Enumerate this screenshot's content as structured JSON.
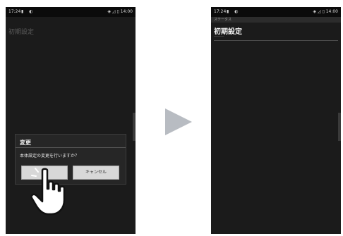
{
  "left_screen": {
    "statusbar": {
      "time": "17:24",
      "notif_icons": "▮ ◐",
      "right_icons": "◈ ◿ ▯ 14:00"
    },
    "title": "初期設定",
    "dialog": {
      "title": "変更",
      "message": "本体設定の変更を行いますか？",
      "ok_label": "OK",
      "cancel_label": "キャンセル"
    }
  },
  "transition": {
    "icon": "play-arrow-icon",
    "color": "#b8bcc2"
  },
  "right_screen": {
    "statusbar": {
      "time": "17:24",
      "notif_icons": "▮ ◐",
      "right_icons": "◈ ◿ ▯ 14:00"
    },
    "appbar_label": "ステータス",
    "title": "初期設定",
    "subtext": "──────"
  },
  "colors": {
    "screen_bg": "#1b1b1b",
    "dialog_bg": "#262626",
    "button_bg": "#d8d8d8"
  }
}
